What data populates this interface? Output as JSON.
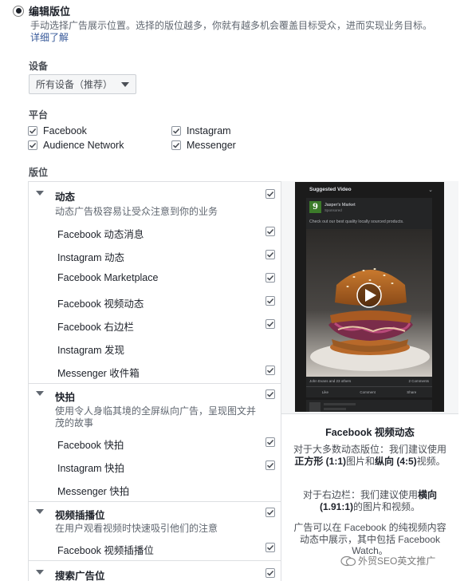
{
  "header": {
    "radio_label": "编辑版位",
    "description": "手动选择广告展示位置。选择的版位越多，你就有越多机会覆盖目标受众，进而实现业务目标。",
    "learn_more": "详细了解"
  },
  "devices": {
    "label": "设备",
    "selected": "所有设备（推荐）"
  },
  "platforms": {
    "label": "平台",
    "items": [
      {
        "label": "Facebook",
        "checked": true
      },
      {
        "label": "Instagram",
        "checked": true
      },
      {
        "label": "Audience Network",
        "checked": true
      },
      {
        "label": "Messenger",
        "checked": true
      }
    ]
  },
  "placements": {
    "label": "版位",
    "groups": [
      {
        "name": "动态",
        "checked": true,
        "description": "动态广告极容易让受众注意到你的业务",
        "items": [
          {
            "label": "Facebook 动态消息",
            "checked": true
          },
          {
            "label": "Instagram 动态",
            "checked": true
          },
          {
            "label": "Facebook Marketplace",
            "checked": true
          },
          {
            "label": "Facebook 视频动态",
            "checked": true
          },
          {
            "label": "Facebook 右边栏",
            "checked": true
          },
          {
            "label": "Instagram 发现",
            "checked": false
          },
          {
            "label": "Messenger 收件箱",
            "checked": true
          }
        ]
      },
      {
        "name": "快拍",
        "checked": true,
        "description": "使用令人身临其境的全屏纵向广告，呈现图文并茂的故事",
        "items": [
          {
            "label": "Facebook 快拍",
            "checked": true
          },
          {
            "label": "Instagram 快拍",
            "checked": true
          },
          {
            "label": "Messenger 快拍",
            "checked": false
          }
        ]
      },
      {
        "name": "视频插播位",
        "checked": true,
        "description": "在用户观看视频时快速吸引他们的注意",
        "items": [
          {
            "label": "Facebook 视频插播位",
            "checked": true
          }
        ]
      },
      {
        "name": "搜索广告位",
        "checked": true,
        "description": "",
        "items": []
      }
    ]
  },
  "preview": {
    "header": "Suggested Video",
    "page_name": "Jasper's Market",
    "sponsored": "Sponsored",
    "post_text": "Check out our best quality locally sourced products.",
    "reactions": "John Evans and 23 others",
    "comments": "2 Comments",
    "actions": [
      "Like",
      "Comment",
      "Share"
    ],
    "logo_glyph": "9",
    "title": "Facebook 视频动态",
    "para1_a": "对于大多数动态版位：我们建议使用",
    "para1_b": "正方形 (1:1)",
    "para1_c": "图片和",
    "para1_d": "纵向 (4:5)",
    "para1_e": "视频。",
    "para2_a": "对于右边栏：我们建议使用",
    "para2_b": "横向 (1.91:1)",
    "para2_c": "的图片和视频。",
    "para3": "广告可以在 Facebook 的纯视频内容动态中展示，其中包括 Facebook Watch。"
  },
  "watermark": "外贸SEO英文推广",
  "colors": {
    "checkmark": "#4b4f56",
    "link": "#365899"
  }
}
